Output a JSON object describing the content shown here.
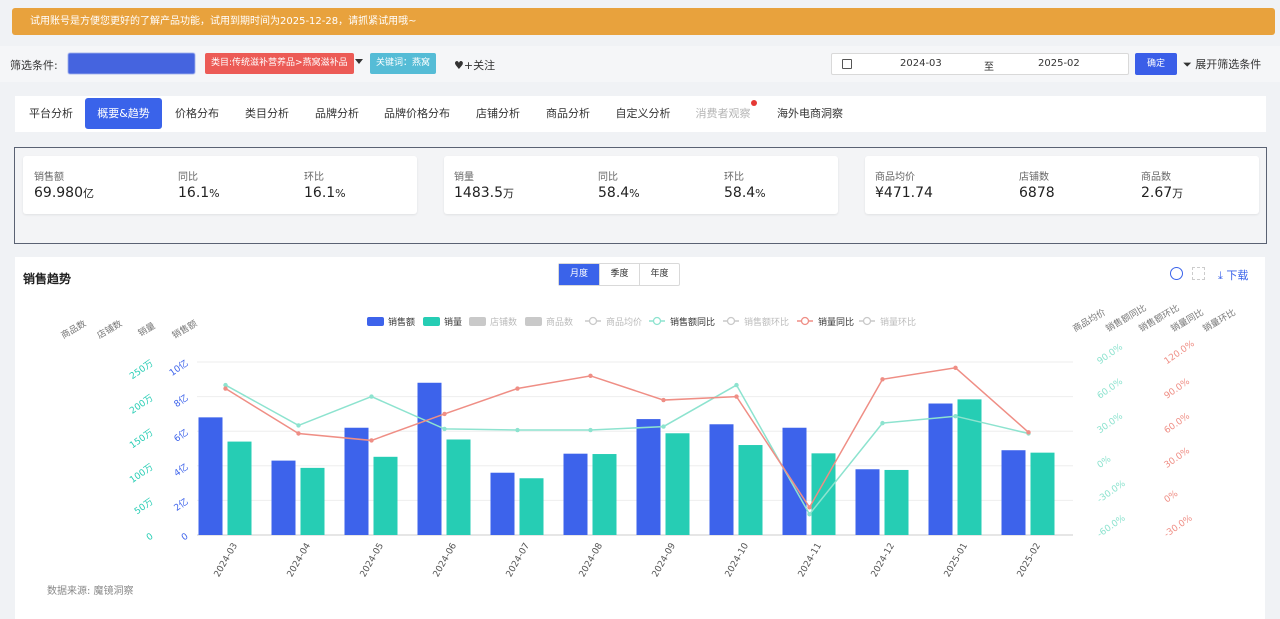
{
  "banner": {
    "text": "试用账号是方便您更好的了解产品功能，试用到期时间为2025-12-28，请抓紧试用哦~"
  },
  "filters": {
    "label": "筛选条件:",
    "category_tag": "类目:传统滋补营养品>燕窝滋补品",
    "keyword_tag": "关键词：燕窝",
    "follow_label": "+关注",
    "date_start": "2024-03",
    "date_to": "至",
    "date_end": "2025-02",
    "confirm_label": "确定",
    "expand_label": "展开筛选条件"
  },
  "tabs": [
    "平台分析",
    "概要&趋势",
    "价格分布",
    "类目分析",
    "品牌分析",
    "品牌价格分布",
    "店铺分析",
    "商品分析",
    "自定义分析",
    "消费者观察",
    "海外电商洞察"
  ],
  "active_tab": "概要&趋势",
  "kpis": [
    {
      "label": "销售额",
      "value": "69.980",
      "unit": "亿"
    },
    {
      "label": "同比",
      "value": "16.1",
      "unit": "%"
    },
    {
      "label": "环比",
      "value": "16.1",
      "unit": "%"
    },
    {
      "label": "销量",
      "value": "1483.5",
      "unit": "万"
    },
    {
      "label": "同比",
      "value": "58.4",
      "unit": "%"
    },
    {
      "label": "环比",
      "value": "58.4",
      "unit": "%"
    },
    {
      "label": "商品均价",
      "value": "¥471.74",
      "unit": ""
    },
    {
      "label": "店铺数",
      "value": "6878",
      "unit": ""
    },
    {
      "label": "商品数",
      "value": "2.67",
      "unit": "万"
    }
  ],
  "panel": {
    "title": "销售趋势",
    "periods": [
      "月度",
      "季度",
      "年度"
    ],
    "active_period": "月度",
    "download_label": "下载",
    "source": "数据来源: 魔镜洞察"
  },
  "chart_data": {
    "type": "bar",
    "categories": [
      "2024-03",
      "2024-04",
      "2024-05",
      "2024-06",
      "2024-07",
      "2024-08",
      "2024-09",
      "2024-10",
      "2024-11",
      "2024-12",
      "2025-01",
      "2025-02"
    ],
    "series": [
      {
        "name": "销售额",
        "kind": "bar",
        "color": "#3d63eb",
        "axis": "left_sales",
        "values": [
          6.8,
          4.3,
          6.2,
          8.8,
          3.6,
          4.7,
          6.7,
          6.4,
          6.2,
          3.8,
          7.6,
          4.9
        ]
      },
      {
        "name": "销量",
        "kind": "bar",
        "color": "#26cdb4",
        "axis": "left_volume",
        "values": [
          135,
          97,
          113,
          138,
          82,
          117,
          147,
          130,
          118,
          94,
          196,
          119
        ]
      },
      {
        "name": "店铺数",
        "kind": "legend-off",
        "color": "#c9c9c9"
      },
      {
        "name": "商品数",
        "kind": "legend-off",
        "color": "#c9c9c9"
      },
      {
        "name": "商品均价",
        "kind": "legend-off-line",
        "color": "#c9c9c9"
      },
      {
        "name": "销售额同比",
        "kind": "line",
        "color": "#8de3cf",
        "axis": "right_sales_yoy",
        "values": [
          70,
          35,
          60,
          32,
          31,
          31,
          34,
          70,
          -42,
          37,
          43,
          28
        ]
      },
      {
        "name": "销售额环比",
        "kind": "legend-off-line",
        "color": "#c9c9c9"
      },
      {
        "name": "销量同比",
        "kind": "line",
        "color": "#ef8e85",
        "axis": "right_volume_yoy",
        "values": [
          97,
          58,
          52,
          75,
          97,
          108,
          87,
          90,
          -6,
          105,
          115,
          59
        ]
      },
      {
        "name": "销量环比",
        "kind": "legend-off-line",
        "color": "#c9c9c9"
      }
    ],
    "left_axes": {
      "titles": [
        "商品数",
        "店铺数",
        "销量",
        "销售额"
      ],
      "sales": {
        "ticks": [
          "0",
          "2亿",
          "4亿",
          "6亿",
          "8亿",
          "10亿"
        ],
        "ylim": [
          0,
          10
        ]
      },
      "volume": {
        "ticks": [
          "0",
          "50万",
          "100万",
          "150万",
          "200万",
          "250万"
        ],
        "ylim": [
          0,
          250
        ]
      }
    },
    "right_axes": {
      "titles": [
        "商品均价",
        "销售额同比",
        "销售额环比",
        "销量同比",
        "销量环比"
      ],
      "sales_yoy": {
        "ticks": [
          "-60.0%",
          "-30.0%",
          "0%",
          "30.0%",
          "60.0%",
          "90.0%"
        ],
        "ylim": [
          -60,
          90
        ]
      },
      "volume_yoy": {
        "ticks": [
          "-30.0%",
          "0%",
          "30.0%",
          "60.0%",
          "90.0%",
          "120.0%"
        ],
        "ylim": [
          -30,
          120
        ]
      }
    },
    "legend_position": "top-center",
    "grid": true
  },
  "colors": {
    "primary": "#3a63ea",
    "banner": "#e8a23d",
    "sales_bar": "#3d63eb",
    "volume_bar": "#26cdb4",
    "sales_yoy": "#8de3cf",
    "volume_yoy": "#ef8e85",
    "disabled": "#c9c9c9"
  }
}
